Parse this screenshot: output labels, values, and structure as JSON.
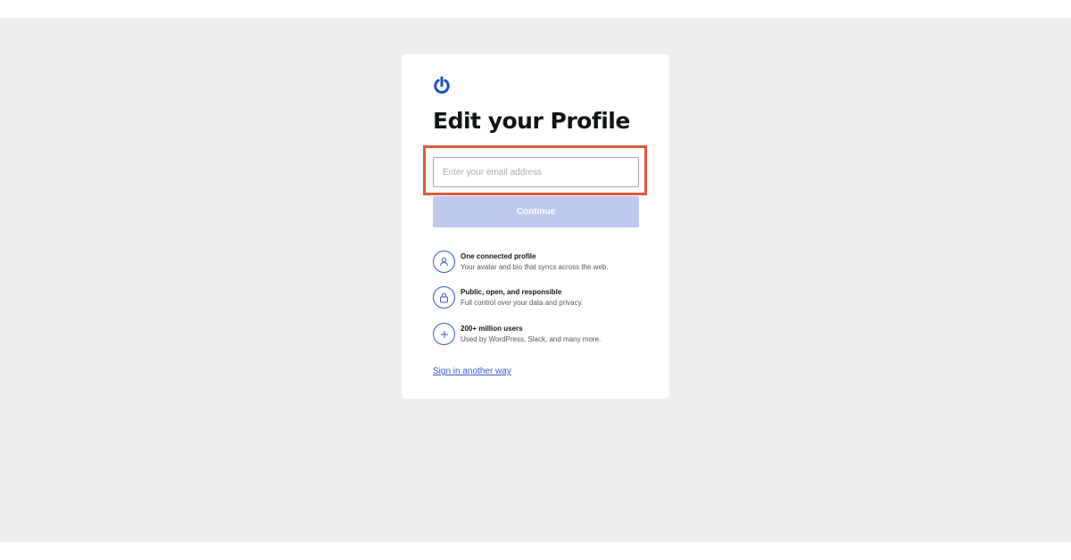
{
  "colors": {
    "accent": "#3858c4",
    "button_disabled": "#bdc9ee",
    "highlight_border": "#dd5a3c",
    "page_background": "#eeeeee"
  },
  "logo": {
    "icon": "power-icon"
  },
  "title": "Edit your Profile",
  "email": {
    "placeholder": "Enter your email address",
    "value": ""
  },
  "continue_label": "Continue",
  "features": [
    {
      "icon": "user-icon",
      "title": "One connected profile",
      "desc": "Your avatar and bio that syncs across the web."
    },
    {
      "icon": "lock-icon",
      "title": "Public, open, and responsible",
      "desc": "Full control over your data and privacy."
    },
    {
      "icon": "plus-icon",
      "title": "200+ million users",
      "desc": "Used by WordPress, Slack, and many more."
    }
  ],
  "signin_link": "Sign in another way"
}
